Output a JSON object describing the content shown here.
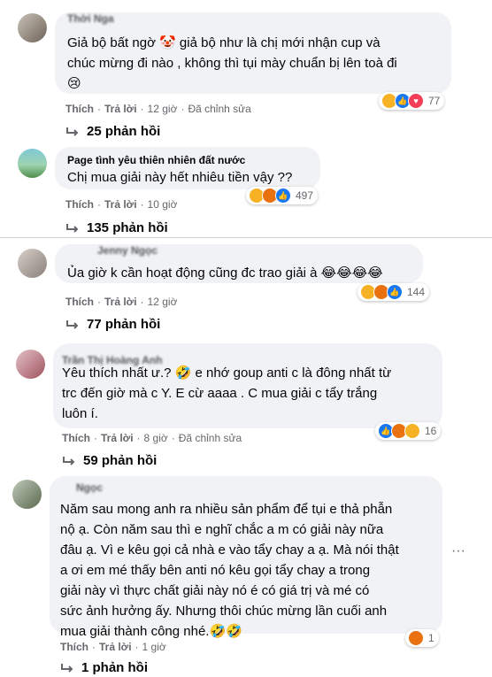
{
  "comments": [
    {
      "name": "Thời Nga",
      "text_lines": [
        "Giả bộ bất ngờ 🤡 giả bộ như là chị mới nhận cup và",
        "chúc mừng đi nào , không thì tụi mày chuẩn bị lên toà đi",
        "😢"
      ],
      "like": "Thích",
      "reply": "Trả lời",
      "time": "12 giờ",
      "edited": "Đã chỉnh sửa",
      "reaction_count": "77",
      "replies": "25 phản hồi"
    },
    {
      "name": "Page tình yêu thiên nhiên đất nước",
      "text_lines": [
        "Chị mua giải này hết nhiêu tiền vậy ??"
      ],
      "like": "Thích",
      "reply": "Trả lời",
      "time": "10 giờ",
      "reaction_count": "497",
      "replies": "135 phản hồi"
    },
    {
      "name": "Jenny Ngọc",
      "text_lines": [
        "Ủa giờ k cần hoạt động cũng đc trao giải à 😂😂😂😂"
      ],
      "like": "Thích",
      "reply": "Trả lời",
      "time": "12 giờ",
      "reaction_count": "144",
      "replies": "77 phản hồi"
    },
    {
      "name": "Trần Thị Hoàng Anh",
      "text_lines": [
        "Yêu thích nhất ư.? 🤣 e nhớ goup anti c là đông nhất từ",
        "trc đến giờ mà c Y. E cừ aaaa . C mua giải c tẩy trắng",
        "luôn í."
      ],
      "like": "Thích",
      "reply": "Trả lời",
      "time": "8 giờ",
      "edited": "Đã chỉnh sửa",
      "reaction_count": "16",
      "replies": "59 phản hồi"
    },
    {
      "name": "Ngọc",
      "text_lines": [
        "Năm sau mong anh ra nhiều sản phẩm để tụi e thả phẫn",
        "nộ ạ. Còn năm sau thì e nghĩ chắc a m   có giải này nữa",
        "đâu ạ. Vì e kêu gọi cả nhà e vào tẩy chay a ạ. Mà nói thật",
        "a ơi em mé   thấy bên anti nó kêu gọi tẩy chay a trong",
        "giải này vì thực chất giải này nó é   có giá trị và mé   có",
        "sức ảnh hưởng ấy. Nhưng thôi chúc mừng lần cuối anh",
        "mua giải thành công nhé.🤣🤣"
      ],
      "like": "Thích",
      "reply": "Trả lời",
      "time": "1 giờ",
      "reaction_count": "1",
      "replies": "1 phản hồi"
    }
  ],
  "more_options": "···"
}
